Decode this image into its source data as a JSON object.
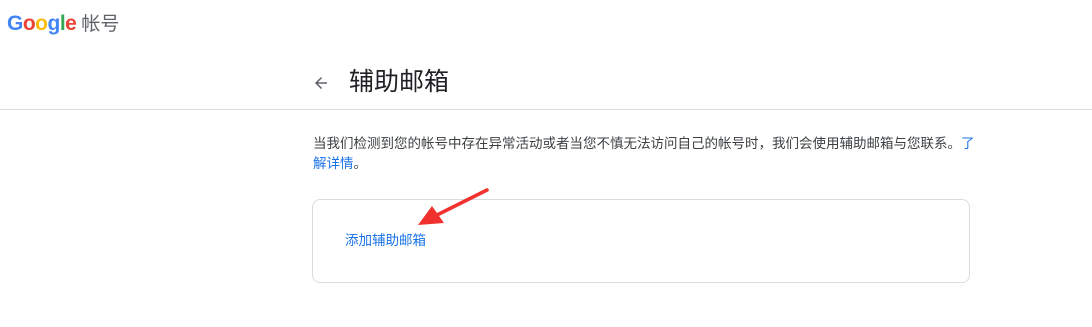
{
  "header": {
    "logo_letters": [
      {
        "char": "G",
        "color": "#4285F4"
      },
      {
        "char": "o",
        "color": "#EA4335"
      },
      {
        "char": "o",
        "color": "#FBBC05"
      },
      {
        "char": "g",
        "color": "#4285F4"
      },
      {
        "char": "l",
        "color": "#34A853"
      },
      {
        "char": "e",
        "color": "#EA4335"
      }
    ],
    "product_name": "帐号"
  },
  "page": {
    "back_icon": "arrow-back-icon",
    "title": "辅助邮箱",
    "description_text": "当我们检测到您的帐号中存在异常活动或者当您不慎无法访问自己的帐号时，我们会使用辅助邮箱与您联系。",
    "learn_more_label": "了解详情",
    "description_end": "。"
  },
  "card": {
    "add_label": "添加辅助邮箱"
  },
  "annotation": {
    "arrow_color": "#f0312e",
    "arrow_icon": "red-arrow-annotation"
  },
  "colors": {
    "link": "#1a73e8",
    "divider": "#dadce0"
  }
}
